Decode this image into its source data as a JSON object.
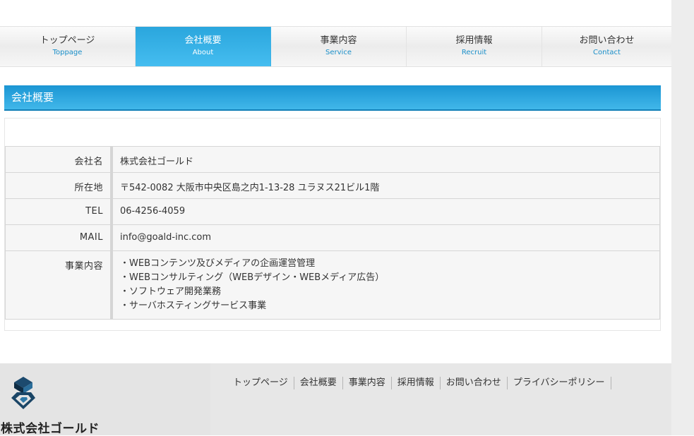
{
  "nav": {
    "items": [
      {
        "jp": "トップページ",
        "en": "Toppage"
      },
      {
        "jp": "会社概要",
        "en": "About"
      },
      {
        "jp": "事業内容",
        "en": "Service"
      },
      {
        "jp": "採用情報",
        "en": "Recruit"
      },
      {
        "jp": "お問い合わせ",
        "en": "Contact"
      }
    ],
    "active": "About"
  },
  "section": {
    "title": "会社概要"
  },
  "company_info": {
    "rows": [
      {
        "label": "会社名",
        "value": "株式会社ゴールド"
      },
      {
        "label": "所在地",
        "value": "〒542-0082 大阪市中央区島之内1-13-28 ユラヌス21ビル1階"
      },
      {
        "label": "TEL",
        "value": "06-4256-4059"
      },
      {
        "label": "MAIL",
        "value": "info@goald-inc.com"
      }
    ],
    "services_label": "事業内容",
    "services": [
      "・WEBコンテンツ及びメディアの企画運営管理",
      "・WEBコンサルティング（WEBデザイン・WEBメディア広告）",
      "・ソフトウェア開発業務",
      "・サーバホスティングサービス事業"
    ]
  },
  "footer": {
    "logo_text": "株式会社ゴールド",
    "links": [
      "トップページ",
      "会社概要",
      "事業内容",
      "採用情報",
      "お問い合わせ",
      "プライバシーポリシー"
    ]
  },
  "colors": {
    "accent": "#2aa6dd",
    "link_en": "#1a8fc9",
    "footer_bg": "#e7e7e7"
  }
}
